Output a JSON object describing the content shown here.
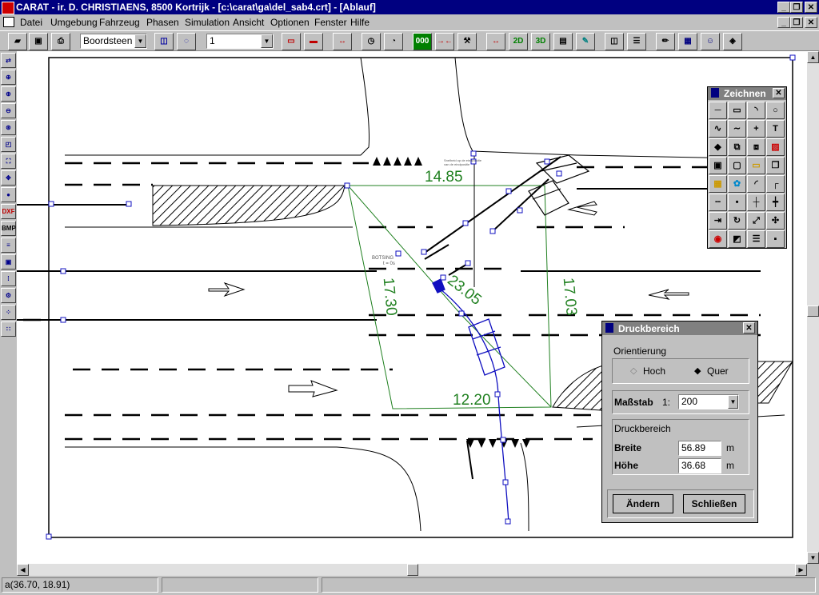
{
  "window": {
    "title": "CARAT - ir. D. CHRISTIAENS, 8500 Kortrijk - [c:\\carat\\ga\\del_sab4.crt] - [Ablauf]",
    "minimize": "_",
    "maximize": "❐",
    "close": "✕"
  },
  "menu": [
    "Datei",
    "Umgebung",
    "Fahrzeug",
    "Phasen",
    "Simulation",
    "Ansicht",
    "Optionen",
    "Fenster",
    "Hilfe"
  ],
  "toolbar": {
    "object_combo": "Boordsteen",
    "layer_combo": "1",
    "btn_2d": "2D",
    "btn_3d": "3D"
  },
  "left_tools": {
    "dxf": "DXF",
    "bmp": "BMP"
  },
  "drawing": {
    "dimensions": [
      "14.85",
      "23.05",
      "17.30",
      "17.03",
      "12.20"
    ],
    "small_label_1": "BOTSING",
    "small_label_2": "t = 0s",
    "small_label_3": "Snelheid op de eindpositie",
    "small_label_4": "van de eindpositie"
  },
  "palette": {
    "title": "Zeichnen",
    "text_tool": "T",
    "plus_tool": "+"
  },
  "dialog": {
    "title": "Druckbereich",
    "orientation_label": "Orientierung",
    "option_hoch": "Hoch",
    "option_quer": "Quer",
    "selected": "Quer",
    "scale_label": "Maßstab",
    "scale_prefix": "1:",
    "scale_value": "200",
    "area_label": "Druckbereich",
    "width_label": "Breite",
    "width_value": "56.89",
    "width_unit": "m",
    "height_label": "Höhe",
    "height_value": "36.68",
    "height_unit": "m",
    "change_button": "Ändern",
    "close_button": "Schließen"
  },
  "status": {
    "coords": "a(36.70, 18.91)"
  },
  "colors": {
    "titlebar": "#000080",
    "dimension_green": "#208020",
    "vehicle_blue": "#1010c0"
  }
}
